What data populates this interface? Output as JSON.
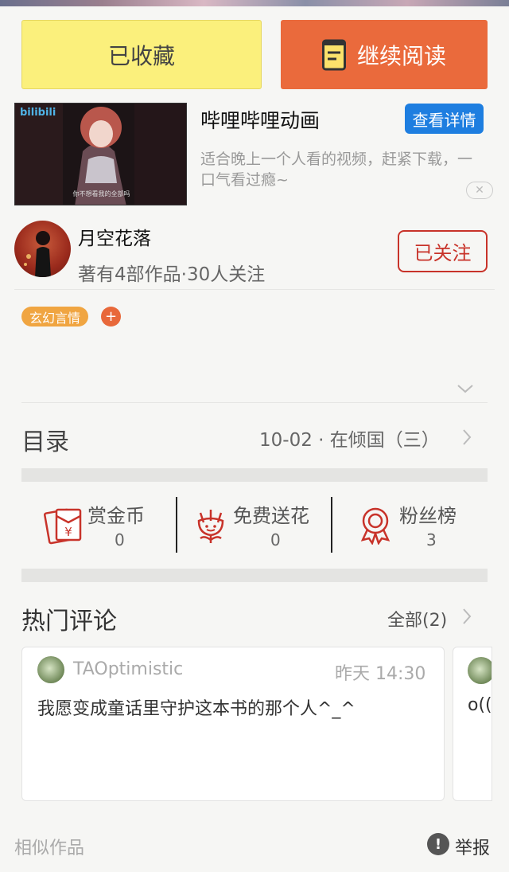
{
  "actions": {
    "favorited_label": "已收藏",
    "read_label": "继续阅读"
  },
  "ad": {
    "thumb_logo": "bilibili",
    "thumb_subtitle": "你不想看我的全部吗",
    "title": "哔哩哔哩动画",
    "details_button": "查看详情",
    "description": "适合晚上一个人看的视频，赶紧下载，一口气看过瘾~",
    "close_glyph": "✕"
  },
  "author": {
    "name": "月空花落",
    "meta": "著有4部作品·30人关注",
    "follow_label": "已关注"
  },
  "tags": {
    "items": [
      "玄幻言情"
    ],
    "add_glyph": "+"
  },
  "toc": {
    "label": "目录",
    "latest": "10-02 · 在倾国（三）",
    "expand_icon": "chevron-down-icon"
  },
  "stats": [
    {
      "label": "赏金币",
      "value": "0",
      "icon": "red-envelope-icon"
    },
    {
      "label": "免费送花",
      "value": "0",
      "icon": "flower-icon"
    },
    {
      "label": "粉丝榜",
      "value": "3",
      "icon": "medal-icon"
    }
  ],
  "comments": {
    "title": "热门评论",
    "all_label": "全部(2)",
    "items": [
      {
        "user": "TAOptimistic",
        "time": "昨天 14:30",
        "text": "我愿变成童话里守护这本书的那个人^_^"
      },
      {
        "text": "o(("
      }
    ]
  },
  "footer": {
    "similar_label": "相似作品",
    "report_label": "举报",
    "report_glyph": "!"
  },
  "colors": {
    "accent_orange": "#ea6a3c",
    "favorite_yellow": "#fbf07c",
    "follow_red": "#c8332a",
    "link_blue": "#1e7ee0",
    "tag_orange": "#f0a541"
  }
}
